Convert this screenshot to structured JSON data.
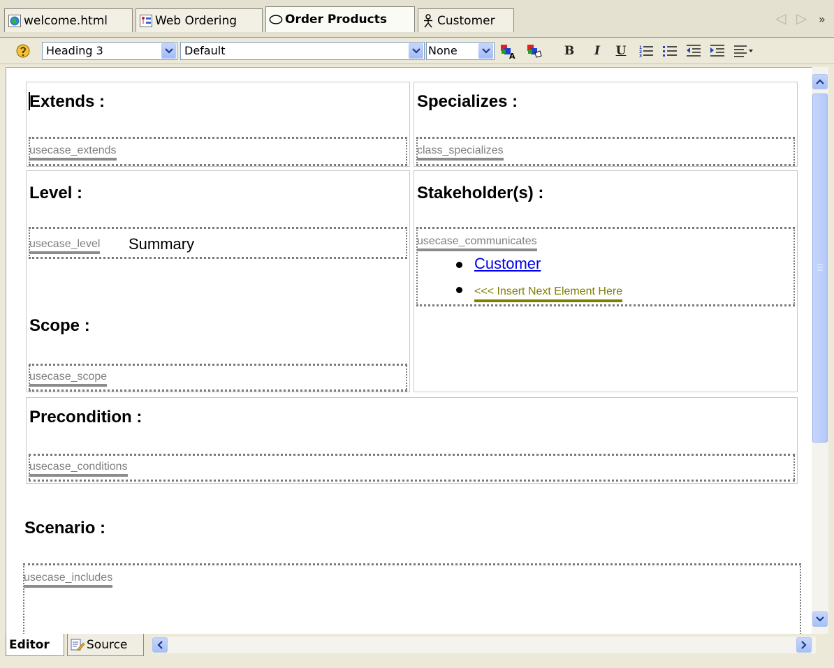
{
  "tabs": [
    {
      "label": "welcome.html",
      "icon": "globe-icon"
    },
    {
      "label": "Web Ordering",
      "icon": "diagram-icon"
    },
    {
      "label": "Order Products",
      "icon": "usecase-ellipse-icon",
      "active": true
    },
    {
      "label": "Customer",
      "icon": "actor-icon"
    }
  ],
  "toolbar": {
    "paragraph_style": "Heading 3",
    "font": "Default",
    "size": "None",
    "bold": "B",
    "italic": "I",
    "underline": "U"
  },
  "document": {
    "extends": {
      "heading": "Extends :",
      "tag": "usecase_extends"
    },
    "specializes": {
      "heading": "Specializes :",
      "tag": "class_specializes"
    },
    "level": {
      "heading": "Level :",
      "tag": "usecase_level",
      "value": "Summary"
    },
    "stakeholders": {
      "heading": "Stakeholder(s) :",
      "tag": "usecase_communicates",
      "items": [
        "Customer"
      ],
      "insert_placeholder": "<<< Insert Next Element Here"
    },
    "scope": {
      "heading": "Scope :",
      "tag": "usecase_scope"
    },
    "precondition": {
      "heading": "Precondition :",
      "tag": "usecase_conditions"
    },
    "scenario": {
      "heading": "Scenario :",
      "tag": "usecase_includes"
    }
  },
  "bottom_tabs": [
    {
      "label": "Editor",
      "active": true
    },
    {
      "label": "Source",
      "icon": "source-edit-icon"
    }
  ],
  "colors": {
    "link": "#0000ee",
    "insert_placeholder": "#808000",
    "tag_text": "#808080"
  }
}
